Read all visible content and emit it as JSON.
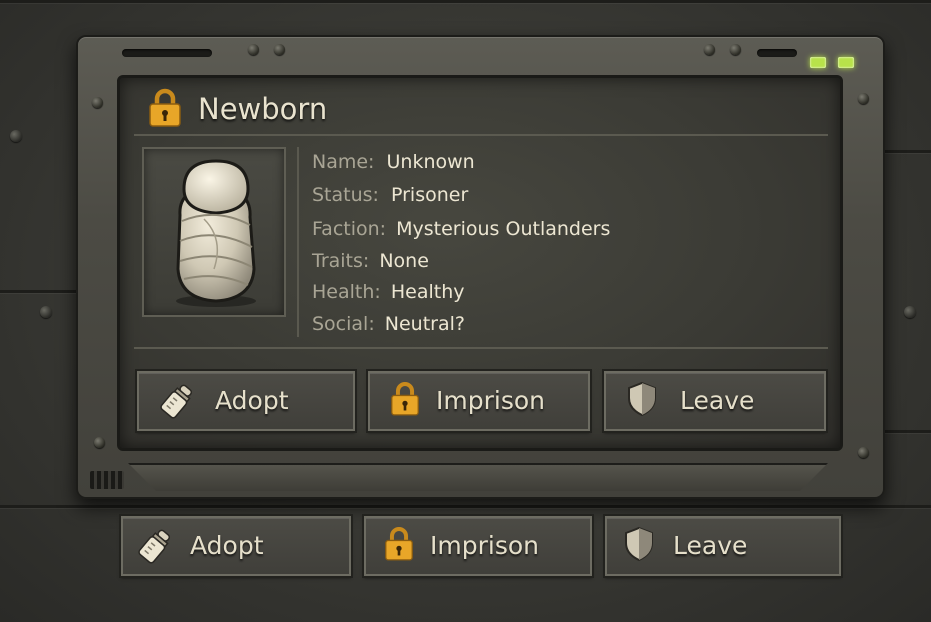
{
  "dialog": {
    "title": "Newborn",
    "fields": [
      {
        "label": "Name:",
        "value": "Unknown"
      },
      {
        "label": "Status:",
        "value": "Prisoner"
      },
      {
        "label": "Faction:",
        "value": "Mysterious Outlanders"
      },
      {
        "label": "Traits:",
        "value": "None"
      },
      {
        "label": "Health:",
        "value": "Healthy"
      },
      {
        "label": "Social:",
        "value": "Neutral?"
      }
    ],
    "actions": {
      "adopt": "Adopt",
      "imprison": "Imprison",
      "leave": "Leave"
    }
  },
  "bottom_actions": {
    "adopt": "Adopt",
    "imprison": "Imprison",
    "leave": "Leave"
  },
  "icons": {
    "title": "lock-icon",
    "adopt": "baby-bottle-icon",
    "imprison": "lock-icon",
    "leave": "shield-icon"
  },
  "colors": {
    "accent_gold": "#e8a628",
    "status_led": "#b8e24a",
    "text": "#ece6d2",
    "label": "#a9a595"
  }
}
